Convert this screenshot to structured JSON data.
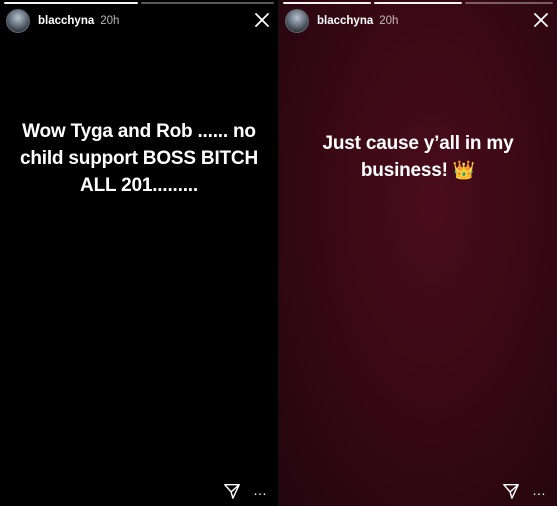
{
  "stories": [
    {
      "username": "blacchyna",
      "time_ago": "20h",
      "text": "Wow Tyga and Rob ...... no child support BOSS BITCH ALL 201.........",
      "emoji": "",
      "background": "#000000"
    },
    {
      "username": "blacchyna",
      "time_ago": "20h",
      "text": "Just cause y’all in my business!",
      "emoji": "👑",
      "background": "#3a0915"
    }
  ],
  "icons": {
    "close": "close-icon",
    "send": "send-icon",
    "more": "more-icon",
    "more_glyph": "…"
  }
}
